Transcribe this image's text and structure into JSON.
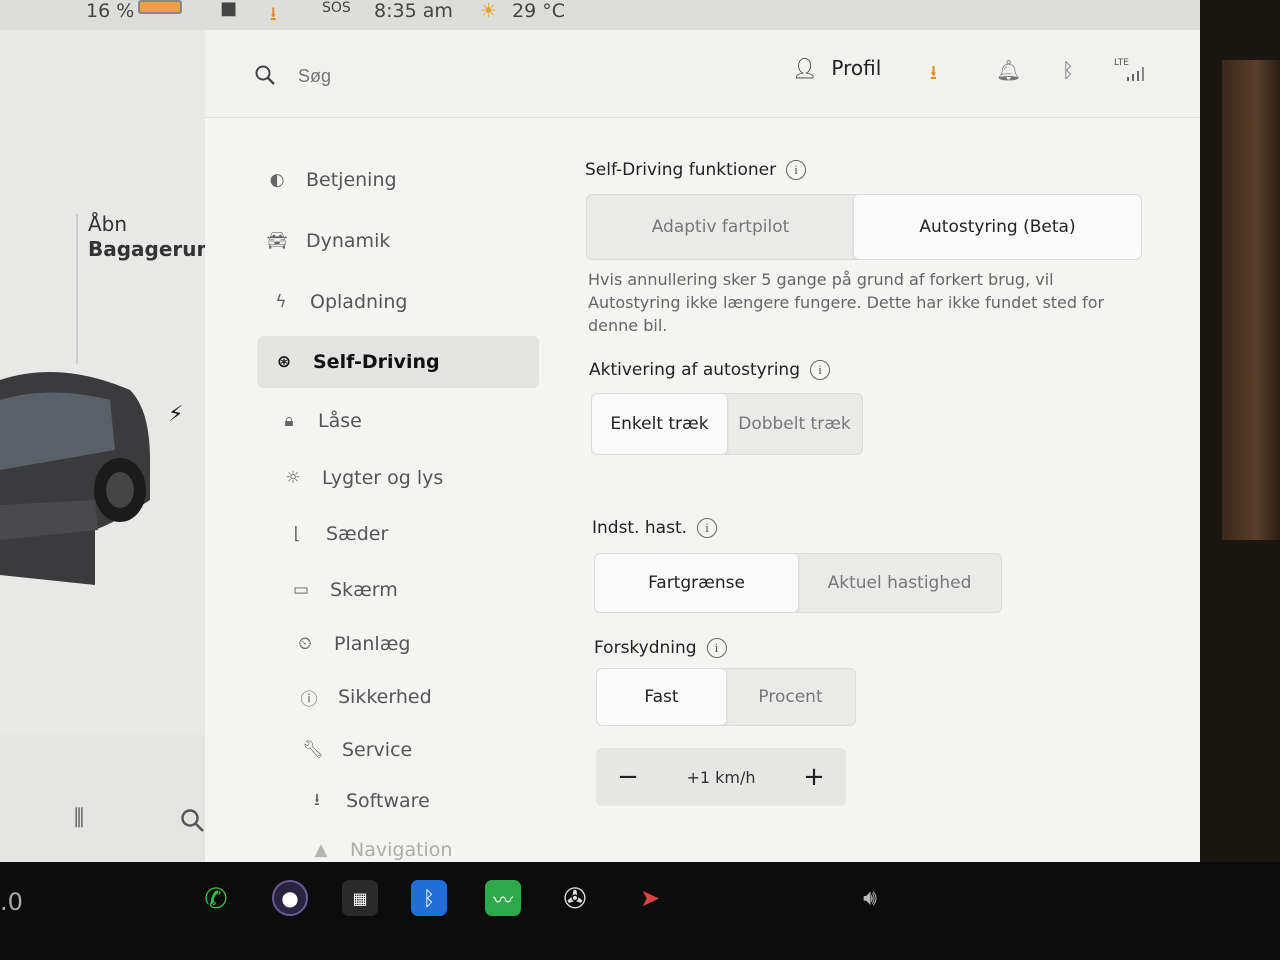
{
  "status_bar": {
    "battery": "16 %",
    "sos": "SOS",
    "time": "8:35 am",
    "temperature": "29 °C"
  },
  "left_panel": {
    "trunk_line1": "Åbn",
    "trunk_line2": "Bagagerum"
  },
  "header": {
    "search_placeholder": "Søg",
    "profile_label": "Profil",
    "lte_label": "LTE"
  },
  "sidebar": {
    "items": [
      {
        "label": "Betjening",
        "icon": "toggle-icon"
      },
      {
        "label": "Dynamik",
        "icon": "car-icon"
      },
      {
        "label": "Opladning",
        "icon": "bolt-icon"
      },
      {
        "label": "Self-Driving",
        "icon": "steering-wheel-icon",
        "active": true
      },
      {
        "label": "Låse",
        "icon": "lock-icon"
      },
      {
        "label": "Lygter og lys",
        "icon": "sun-icon"
      },
      {
        "label": "Sæder",
        "icon": "seat-icon"
      },
      {
        "label": "Skærm",
        "icon": "display-icon"
      },
      {
        "label": "Planlæg",
        "icon": "clock-icon"
      },
      {
        "label": "Sikkerhed",
        "icon": "alert-icon"
      },
      {
        "label": "Service",
        "icon": "wrench-icon"
      },
      {
        "label": "Software",
        "icon": "download-icon"
      },
      {
        "label": "Navigation",
        "icon": "navigation-icon"
      }
    ]
  },
  "content": {
    "self_driving_title": "Self-Driving funktioner",
    "self_driving_options": [
      "Adaptiv fartpilot",
      "Autostyring (Beta)"
    ],
    "self_driving_selected": 1,
    "description": "Hvis annullering sker 5 gange på grund af forkert brug, vil Autostyring ikke længere fungere. Dette har ikke fundet sted for denne bil.",
    "activation_title": "Aktivering af autostyring",
    "activation_options": [
      "Enkelt træk",
      "Dobbelt træk"
    ],
    "activation_selected": 0,
    "speed_title": "Indst. hast.",
    "speed_options": [
      "Fartgrænse",
      "Aktuel hastighed"
    ],
    "speed_selected": 0,
    "offset_title": "Forskydning",
    "offset_options": [
      "Fast",
      "Procent"
    ],
    "offset_selected": 0,
    "offset_value": "+1 km/h",
    "minus": "−",
    "plus": "+"
  },
  "taskbar": {
    "speed_partial": ".0"
  },
  "colors": {
    "accent_orange": "#e08a1e",
    "bluetooth_blue": "#1f6fd6",
    "green_app": "#2da84a",
    "phone_green": "#2fbf4a"
  }
}
